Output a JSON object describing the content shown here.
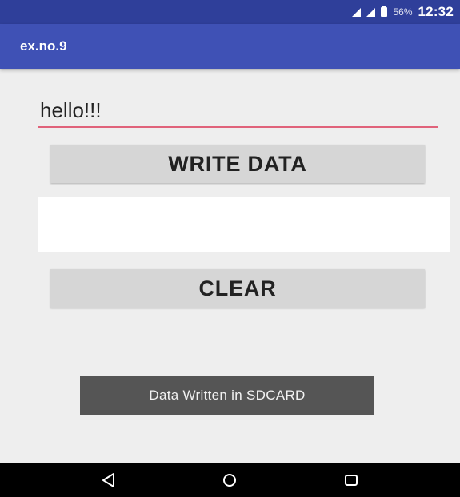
{
  "status_bar": {
    "battery_percent": "56%",
    "time": "12:32",
    "signal_icons": [
      "signal-icon",
      "signal-icon"
    ],
    "battery_icon": "battery-icon"
  },
  "app_bar": {
    "title": "ex.no.9",
    "color": "#3f51b5"
  },
  "form": {
    "input_value": "hello!!!",
    "input_underline_color": "#e0627a",
    "write_button_label": "WRITE DATA",
    "read_value": "",
    "clear_button_label": "CLEAR"
  },
  "toast": {
    "message": "Data Written in SDCARD"
  },
  "nav_bar": {
    "buttons": [
      "back-icon",
      "home-icon",
      "recents-icon"
    ]
  }
}
